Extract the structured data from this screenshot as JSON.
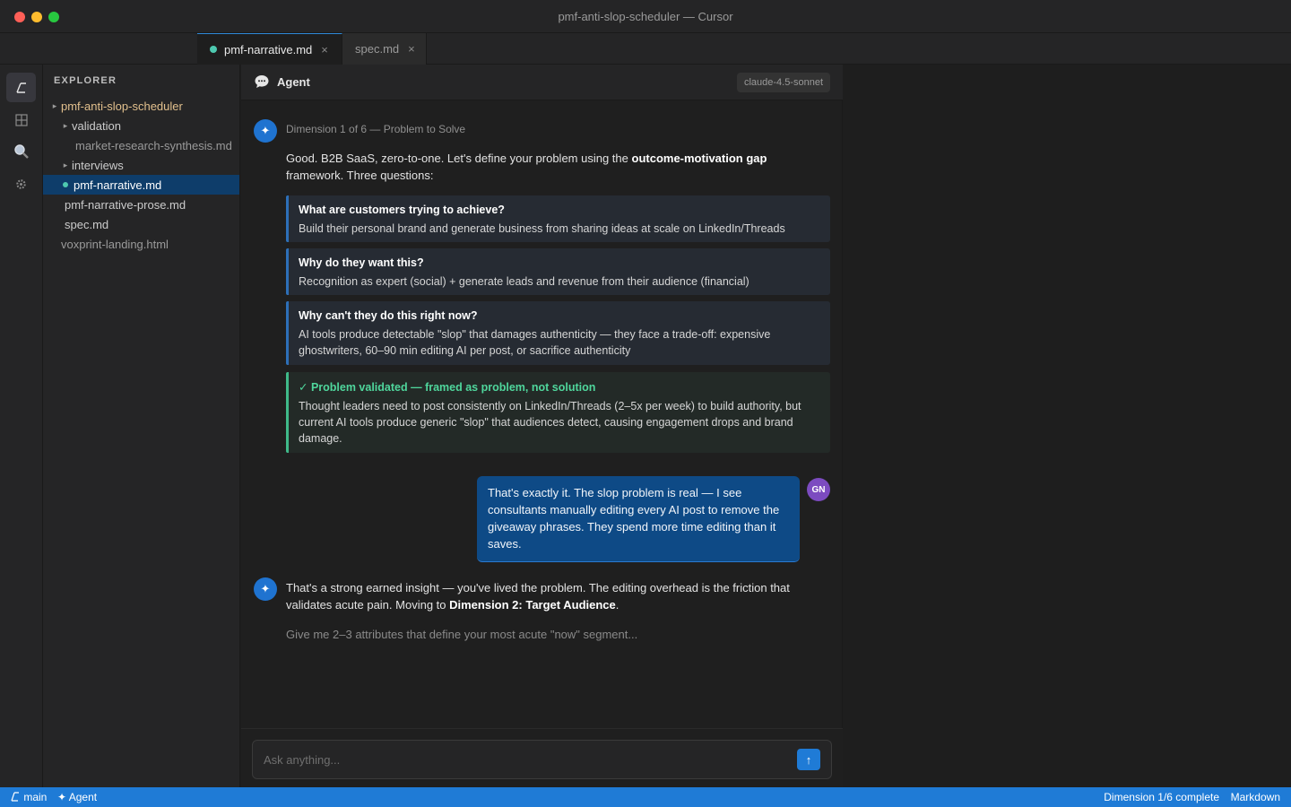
{
  "window": {
    "title": "pmf-anti-slop-scheduler — Cursor"
  },
  "tabs": [
    {
      "label": "pmf-narrative.md",
      "active": true,
      "modified": true
    },
    {
      "label": "spec.md",
      "active": false
    }
  ],
  "icons": {
    "tab_close": "×",
    "folder_chevron": "▸",
    "ai": "✦",
    "send": "↑"
  },
  "activity_bar": [
    "source-control-icon",
    "extensions-icon",
    "search-icon",
    "settings-icon"
  ],
  "explorer": {
    "title": "EXPLORER",
    "items": [
      {
        "label": "pmf-anti-slop-scheduler",
        "type": "root-folder"
      },
      {
        "label": "validation",
        "type": "folder"
      },
      {
        "label": "market-research-synthesis.md",
        "type": "file"
      },
      {
        "label": "interviews",
        "type": "folder"
      },
      {
        "label": "pmf-narrative.md",
        "type": "file",
        "selected": true
      },
      {
        "label": "pmf-narrative-prose.md",
        "type": "file"
      },
      {
        "label": "spec.md",
        "type": "file"
      },
      {
        "label": "voxprint-landing.html",
        "type": "file"
      }
    ]
  },
  "agent": {
    "title": "Agent",
    "model": "claude-4.5-sonnet",
    "messages": {
      "first": {
        "meta": "Dimension 1 of 6 — Problem to Solve",
        "intro_pre": "Good. B2B SaaS, zero-to-one. Let's define your problem using the ",
        "intro_bold": "outcome-motivation gap",
        "intro_post": " framework. Three questions:",
        "cards": [
          {
            "q": "What are customers trying to achieve?",
            "a": "Build their personal brand and generate business from sharing ideas at scale on LinkedIn/Threads"
          },
          {
            "q": "Why do they want this?",
            "a": "Recognition as expert (social) + generate leads and revenue from their audience (financial)"
          },
          {
            "q": "Why can't they do this right now?",
            "a": "AI tools produce detectable \"slop\" that damages authenticity — they face a trade-off: expensive ghostwriters, 60–90 min editing AI per post, or sacrifice authenticity"
          }
        ],
        "validated": {
          "title": "✓ Problem validated — framed as problem, not solution",
          "text": "Thought leaders need to post consistently on LinkedIn/Threads (2–5x per week) to build authority, but current AI tools produce generic \"slop\" that audiences detect, causing engagement drops and brand damage."
        }
      },
      "user": {
        "initials": "GN",
        "text": "That's exactly it. The slop problem is real — I see consultants manually editing every AI post to remove the giveaway phrases. They spend more time editing than it saves."
      },
      "second": {
        "text_pre": "That's a strong earned insight — you've lived the problem. The editing overhead is the friction that validates acute pain. Moving to ",
        "text_bold": "Dimension 2: Target Audience",
        "text_post": ".",
        "followup": "Give me 2–3 attributes that define your most acute \"now\" segment..."
      }
    },
    "composer": {
      "placeholder": "Ask anything..."
    }
  },
  "statusbar": {
    "branch": "main",
    "mode": "Agent",
    "progress": "Dimension 1/6 complete",
    "language": "Markdown"
  },
  "colors": {
    "accent": "#1f7bd6",
    "success": "#4fd69c",
    "user_bubble": "#0e4a86",
    "folder_highlight": "#e2c08d"
  }
}
